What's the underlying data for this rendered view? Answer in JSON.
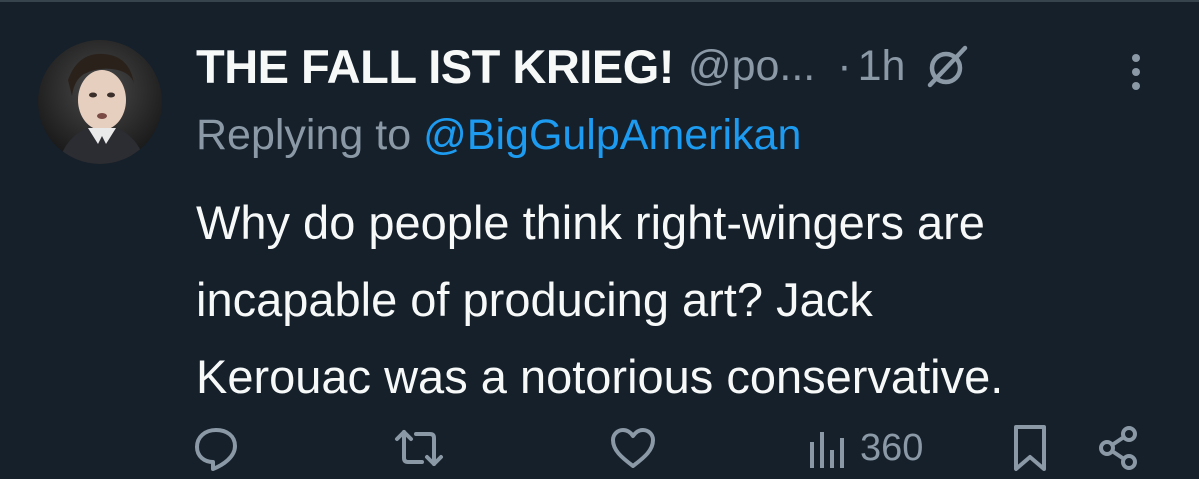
{
  "tweet": {
    "display_name": "THE FALL IST KRIEG!",
    "handle": "@po...",
    "separator": "·",
    "time": "1h",
    "replying_label": "Replying to",
    "reply_to_handle": "@BigGulpAmerikan",
    "text_lines": [
      "Why do people think right-wingers are",
      "incapable of producing art? Jack",
      "Kerouac was a notorious conservative."
    ],
    "views_count": "360"
  },
  "icons": {
    "header": [
      "grok-icon",
      "more-options-icon"
    ],
    "actions": [
      "reply-icon",
      "retweet-icon",
      "like-icon",
      "views-icon",
      "bookmark-icon",
      "share-icon"
    ]
  },
  "colors": {
    "background": "#15202b",
    "text_primary": "#f7f9f9",
    "text_secondary": "#8b98a5",
    "link": "#1d9bf0"
  }
}
